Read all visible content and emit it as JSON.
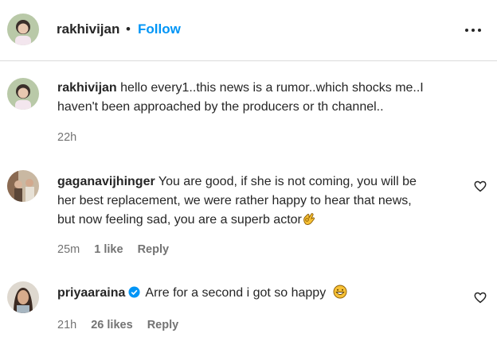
{
  "header": {
    "username": "rakhivijan",
    "separator": "•",
    "follow_label": "Follow",
    "more_icon": "more-horizontal-icon"
  },
  "comments": [
    {
      "username": "rakhivijan",
      "text_line1": "hello every1..this news is a rumor..which shocks me..I",
      "text_line2": "haven't been approached by the producers or th channel..",
      "time": "22h"
    },
    {
      "username": "gaganavijhinger",
      "text_line1": "You are good, if she is not coming, you will be",
      "text_line2": "her best replacement, we were rather happy to hear that news,",
      "text_line3": "but now feeling sad, you are a superb actor",
      "emoji": "ok-hand-emoji",
      "time": "25m",
      "likes": "1 like",
      "reply_label": "Reply"
    },
    {
      "username": "priyaaraina",
      "verified": true,
      "text_line1": "Arre for a second i got so happy",
      "emoji": "grinning-face-emoji",
      "time": "21h",
      "likes": "26 likes",
      "reply_label": "Reply"
    }
  ],
  "colors": {
    "link_blue": "#0095f6",
    "text": "#262626",
    "muted": "#737373",
    "verified": "#0095f6"
  }
}
